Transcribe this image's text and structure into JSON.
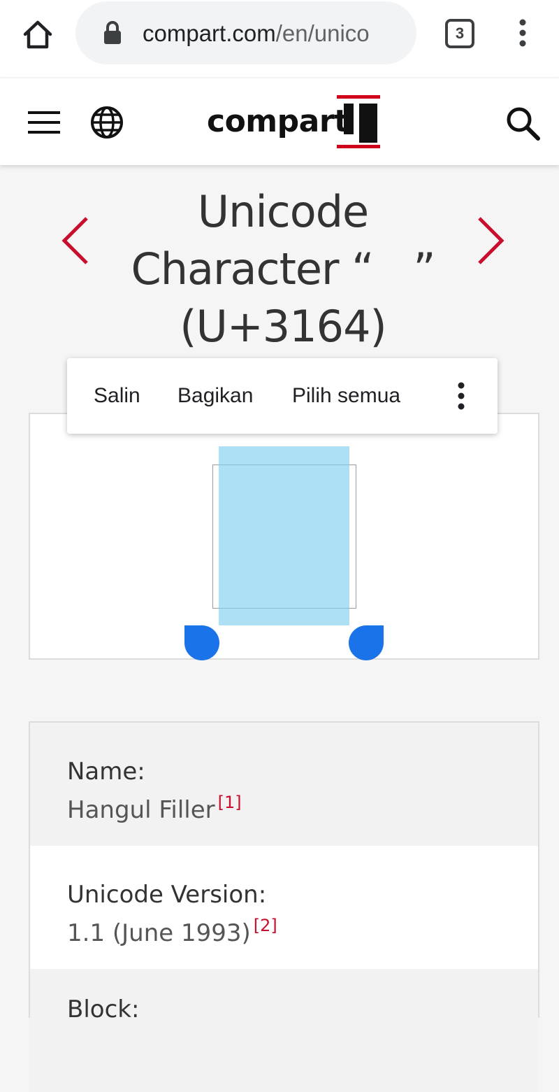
{
  "browser": {
    "url_host": "compart.com",
    "url_path": "/en/unico",
    "tab_count": "3",
    "icons": [
      "home-icon",
      "lock-icon",
      "tab-switcher-icon",
      "overflow-menu-icon"
    ]
  },
  "site_header": {
    "logo_text": "compart",
    "icons": [
      "hamburger-menu-icon",
      "globe-icon",
      "search-icon"
    ],
    "colors": {
      "logo_accent": "#d0021b",
      "logo_text": "#111111"
    }
  },
  "title": {
    "text": "Unicode Character “ㅤ” (U+3164)",
    "prev_icon": "chevron-left-icon",
    "next_icon": "chevron-right-icon",
    "arrow_color": "#c8102e"
  },
  "context_menu": {
    "copy": "Salin",
    "share": "Bagikan",
    "select_all": "Pilih semua",
    "more_icon": "vertical-dots-icon"
  },
  "selection_color": "#81d0f0",
  "handle_color": "#1a73e8",
  "properties": [
    {
      "label": "Name:",
      "value": "Hangul Filler",
      "ref": "[1]"
    },
    {
      "label": "Unicode Version:",
      "value": "1.1 (June 1993)",
      "ref": "[2]"
    },
    {
      "label": "Block:"
    }
  ]
}
